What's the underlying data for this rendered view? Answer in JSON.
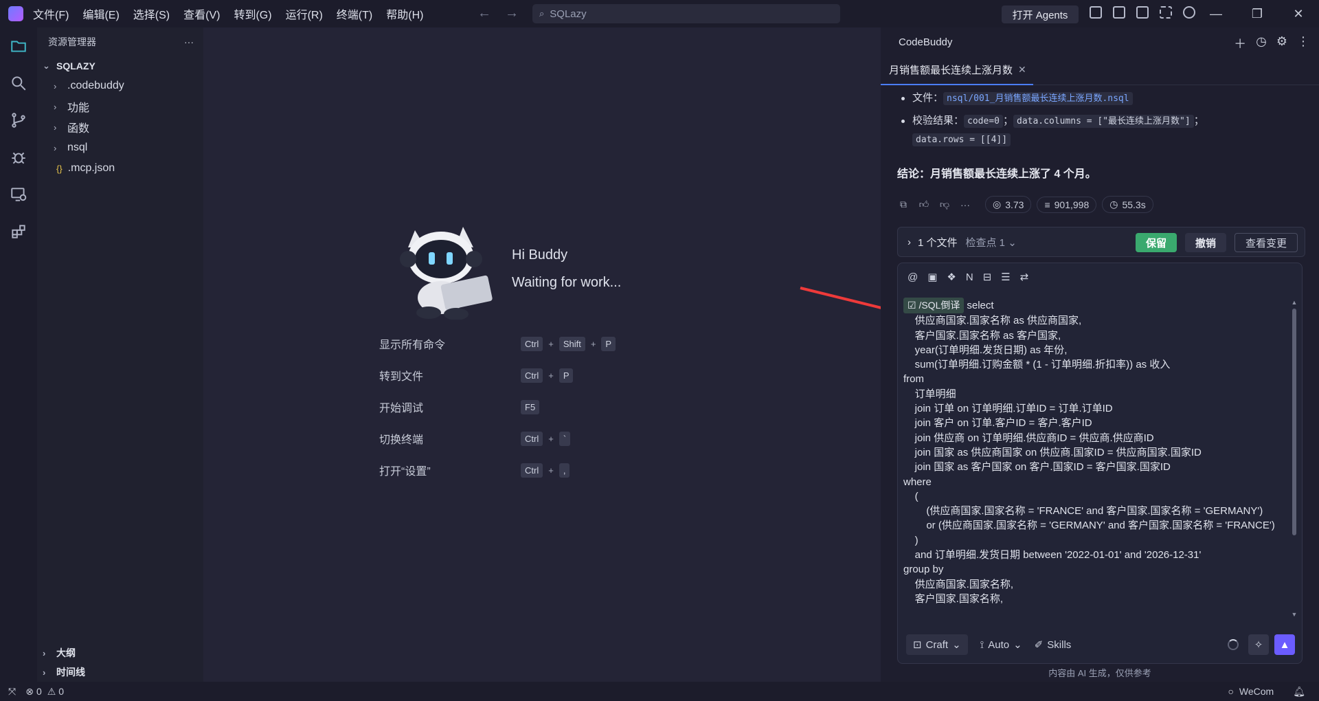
{
  "menu": [
    "文件(F)",
    "编辑(E)",
    "选择(S)",
    "查看(V)",
    "转到(G)",
    "运行(R)",
    "终端(T)",
    "帮助(H)"
  ],
  "search": {
    "text": "SQLazy"
  },
  "agents_button": "打开 Agents",
  "explorer": {
    "title": "资源管理器",
    "more": "···",
    "root": "SQLAZY",
    "items": [
      ".codebuddy",
      "功能",
      "函数",
      "nsql"
    ],
    "file": ".mcp.json",
    "bottom": [
      "大纲",
      "时间线"
    ]
  },
  "welcome": {
    "greeting": "Hi Buddy",
    "status": "Waiting for work...",
    "shortcuts": [
      {
        "label": "显示所有命令",
        "keys": [
          "Ctrl",
          "Shift",
          "P"
        ]
      },
      {
        "label": "转到文件",
        "keys": [
          "Ctrl",
          "P"
        ]
      },
      {
        "label": "开始调试",
        "keys": [
          "F5"
        ]
      },
      {
        "label": "切换终端",
        "keys": [
          "Ctrl",
          "`"
        ]
      },
      {
        "label": "打开“设置”",
        "keys": [
          "Ctrl",
          ","
        ]
      }
    ]
  },
  "panel": {
    "title": "CodeBuddy",
    "tab": "月销售额最长连续上涨月数",
    "file_label": "文件：",
    "file_path": "nsql/001_月销售额最长连续上涨月数.nsql",
    "check_label": "校验结果：",
    "check_code": "code=0",
    "check_sep": "；",
    "check_columns": "data.columns = [\"最长连续上涨月数\"]",
    "check_sep2": "；",
    "check_rows": "data.rows = [[4]]",
    "conclusion": "结论：月销售额最长连续上涨了 4 个月。",
    "stats": {
      "cost": "3.73",
      "tokens": "901,998",
      "time": "55.3s"
    },
    "file_bar": {
      "files": "1 个文件",
      "checkpoint": "检查点 1",
      "keep": "保留",
      "undo": "撤销",
      "view": "查看变更"
    },
    "command_chip": "/SQL倒译",
    "sql_text": "select\n    供应商国家.国家名称 as 供应商国家,\n    客户国家.国家名称 as 客户国家,\n    year(订单明细.发货日期) as 年份,\n    sum(订单明细.订购金额 * (1 - 订单明细.折扣率)) as 收入\nfrom\n    订单明细\n    join 订单 on 订单明细.订单ID = 订单.订单ID\n    join 客户 on 订单.客户ID = 客户.客户ID\n    join 供应商 on 订单明细.供应商ID = 供应商.供应商ID\n    join 国家 as 供应商国家 on 供应商.国家ID = 供应商国家.国家ID\n    join 国家 as 客户国家 on 客户.国家ID = 客户国家.国家ID\nwhere\n    (\n        (供应商国家.国家名称 = 'FRANCE' and 客户国家.国家名称 = 'GERMANY')\n        or (供应商国家.国家名称 = 'GERMANY' and 客户国家.国家名称 = 'FRANCE')\n    )\n    and 订单明细.发货日期 between '2022-01-01' and '2026-12-31'\ngroup by\n    供应商国家.国家名称,\n    客户国家.国家名称,",
    "mode": "Craft",
    "model": "Auto",
    "skills": "Skills",
    "disclaimer": "内容由 AI 生成，仅供参考"
  },
  "status": {
    "errors": "0",
    "warnings": "0",
    "wecom": "WeCom"
  }
}
